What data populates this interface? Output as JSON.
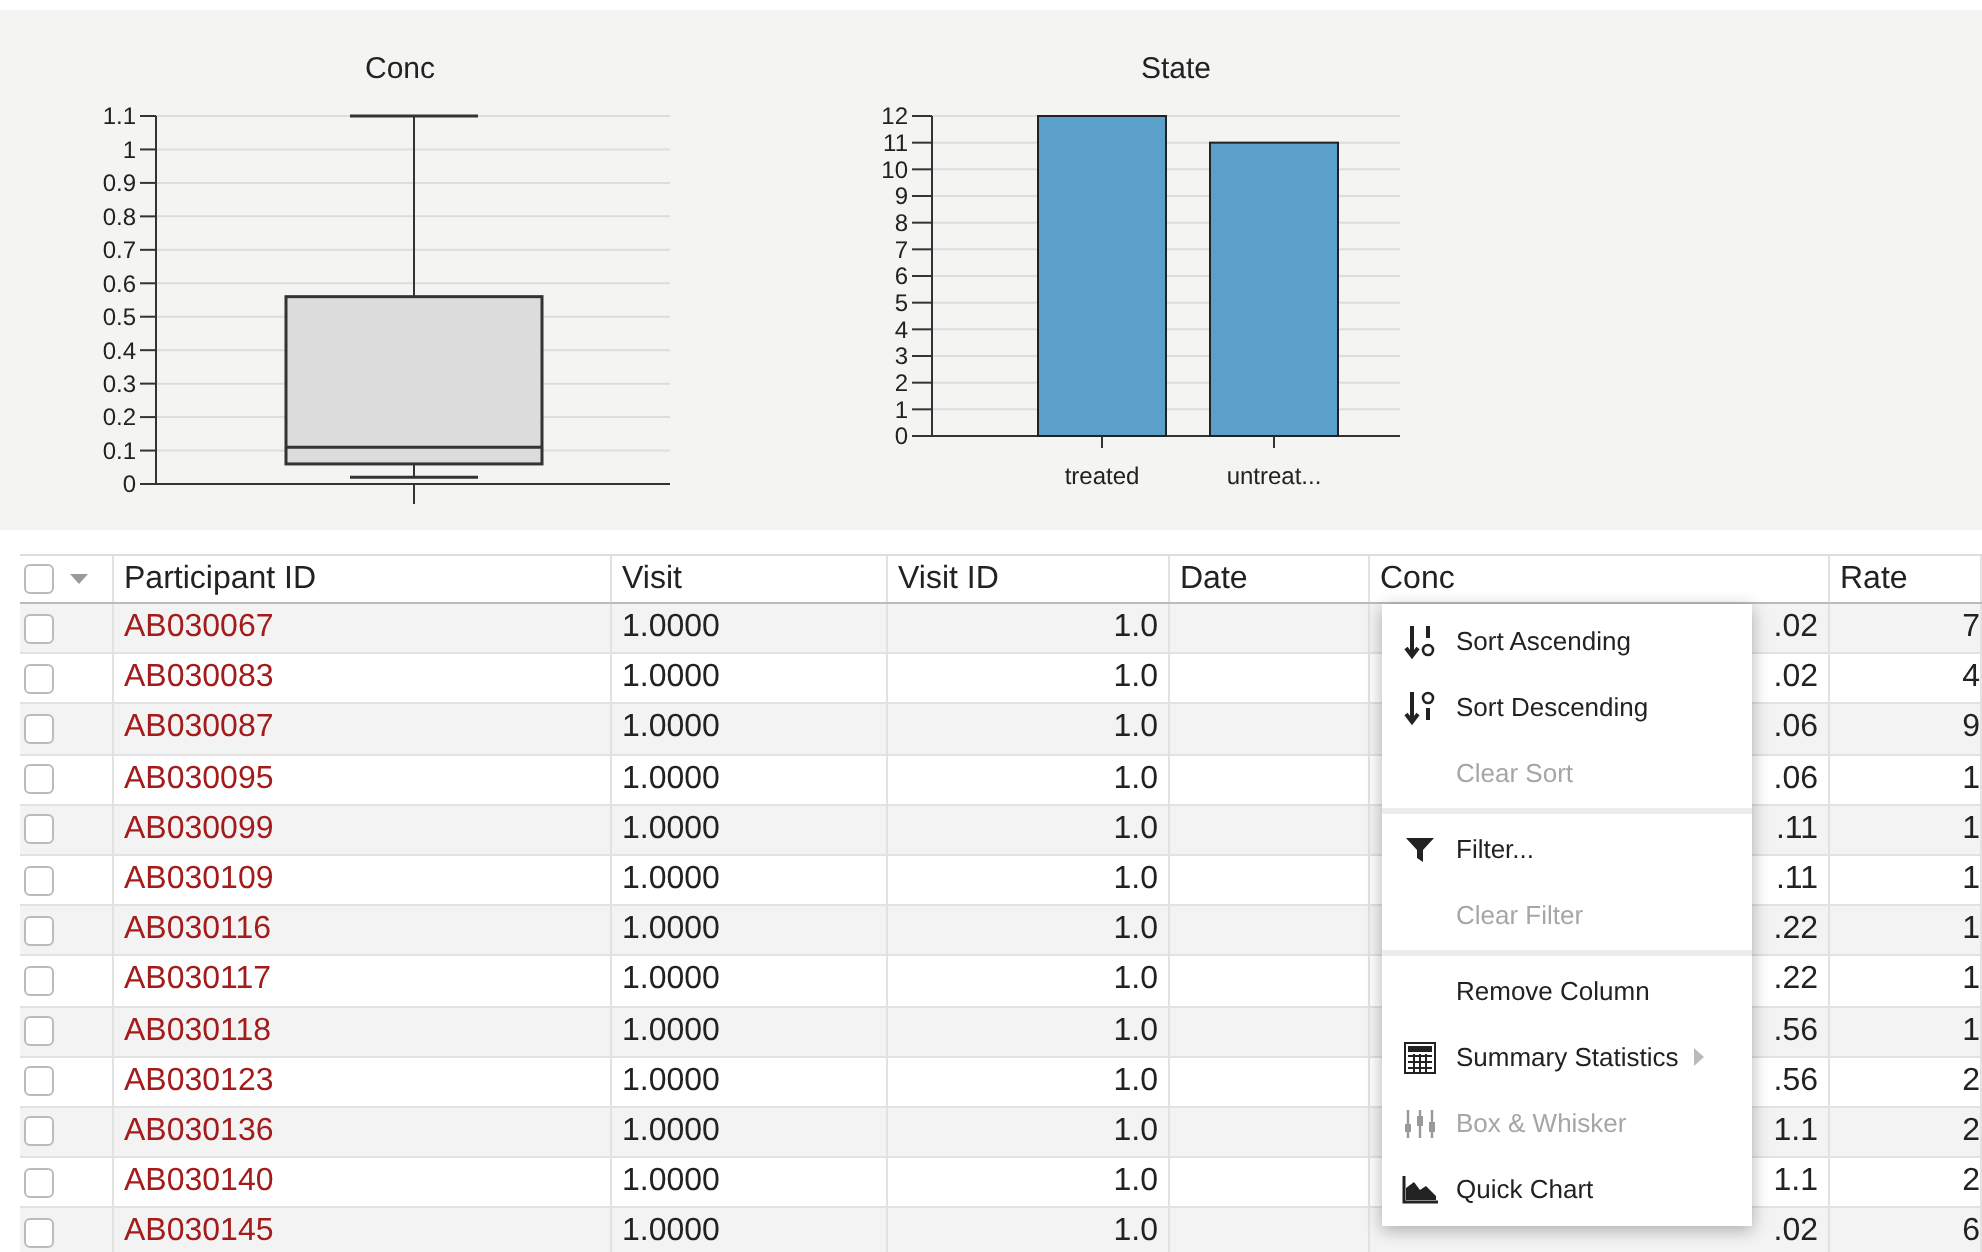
{
  "charts": [
    {
      "chart_data": {
        "type": "box",
        "title": "Conc",
        "grid": true,
        "ylim": [
          0,
          1.1
        ],
        "yticks": [
          0,
          0.1,
          0.2,
          0.3,
          0.4,
          0.5,
          0.6,
          0.7,
          0.8,
          0.9,
          1,
          1.1
        ],
        "boxes": [
          {
            "low": 0.02,
            "q1": 0.06,
            "median": 0.11,
            "q3": 0.56,
            "high": 1.1
          }
        ]
      }
    },
    {
      "chart_data": {
        "type": "bar",
        "title": "State",
        "grid": true,
        "categories": [
          "treated",
          "untreat..."
        ],
        "values": [
          12,
          11
        ],
        "ylim": [
          0,
          12
        ],
        "yticks": [
          0,
          1,
          2,
          3,
          4,
          5,
          6,
          7,
          8,
          9,
          10,
          11,
          12
        ]
      }
    }
  ],
  "table": {
    "header_checkbox": {
      "checked": false
    },
    "columns": [
      "Participant ID",
      "Visit",
      "Visit ID",
      "Date",
      "Conc",
      "Rate"
    ],
    "rows": [
      {
        "checked": false,
        "participant_id": "AB030067",
        "visit": "1.0000",
        "visit_id": "1.0",
        "conc": ".02",
        "rate": "7"
      },
      {
        "checked": false,
        "participant_id": "AB030083",
        "visit": "1.0000",
        "visit_id": "1.0",
        "conc": ".02",
        "rate": "4"
      },
      {
        "checked": false,
        "participant_id": "AB030087",
        "visit": "1.0000",
        "visit_id": "1.0",
        "conc": ".06",
        "rate": "9"
      },
      {
        "checked": false,
        "participant_id": "AB030095",
        "visit": "1.0000",
        "visit_id": "1.0",
        "conc": ".06",
        "rate": "1"
      },
      {
        "checked": false,
        "participant_id": "AB030099",
        "visit": "1.0000",
        "visit_id": "1.0",
        "conc": ".11",
        "rate": "1"
      },
      {
        "checked": false,
        "participant_id": "AB030109",
        "visit": "1.0000",
        "visit_id": "1.0",
        "conc": ".11",
        "rate": "1"
      },
      {
        "checked": false,
        "participant_id": "AB030116",
        "visit": "1.0000",
        "visit_id": "1.0",
        "conc": ".22",
        "rate": "1"
      },
      {
        "checked": false,
        "participant_id": "AB030117",
        "visit": "1.0000",
        "visit_id": "1.0",
        "conc": ".22",
        "rate": "1"
      },
      {
        "checked": false,
        "participant_id": "AB030118",
        "visit": "1.0000",
        "visit_id": "1.0",
        "conc": ".56",
        "rate": "1"
      },
      {
        "checked": false,
        "participant_id": "AB030123",
        "visit": "1.0000",
        "visit_id": "1.0",
        "conc": ".56",
        "rate": "2"
      },
      {
        "checked": false,
        "participant_id": "AB030136",
        "visit": "1.0000",
        "visit_id": "1.0",
        "conc": "1.1",
        "rate": "2"
      },
      {
        "checked": false,
        "participant_id": "AB030140",
        "visit": "1.0000",
        "visit_id": "1.0",
        "conc": "1.1",
        "rate": "2"
      },
      {
        "checked": false,
        "participant_id": "AB030145",
        "visit": "1.0000",
        "visit_id": "1.0",
        "conc": ".02",
        "rate": "6"
      }
    ]
  },
  "column_menu": {
    "items": [
      {
        "kind": "sort-asc",
        "label": "Sort Ascending",
        "disabled": false
      },
      {
        "kind": "sort-desc",
        "label": "Sort Descending",
        "disabled": false
      },
      {
        "kind": "plain",
        "label": "Clear Sort",
        "disabled": true
      },
      {
        "kind": "separator"
      },
      {
        "kind": "filter",
        "label": "Filter...",
        "disabled": false
      },
      {
        "kind": "plain",
        "label": "Clear Filter",
        "disabled": true
      },
      {
        "kind": "separator"
      },
      {
        "kind": "plain",
        "label": "Remove Column",
        "disabled": false
      },
      {
        "kind": "stats",
        "label": "Summary Statistics",
        "disabled": false,
        "submenu": true
      },
      {
        "kind": "box",
        "label": "Box & Whisker",
        "disabled": true
      },
      {
        "kind": "chart",
        "label": "Quick Chart",
        "disabled": false
      }
    ]
  }
}
